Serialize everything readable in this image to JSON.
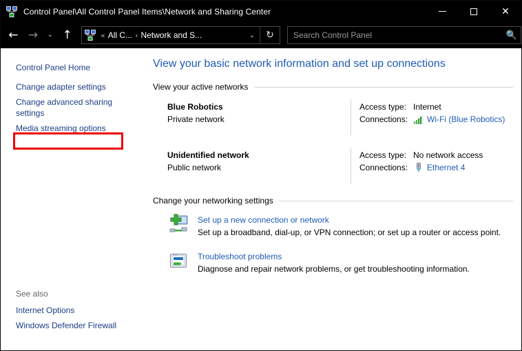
{
  "window": {
    "title": "Control Panel\\All Control Panel Items\\Network and Sharing Center",
    "icon": "network-sharing-center-icon",
    "controls": {
      "minimize": "—",
      "maximize": "□",
      "close": "✕"
    }
  },
  "nav": {
    "back": "←",
    "forward": "→",
    "recent": "⌄",
    "up": "↑",
    "breadcrumb": {
      "overflow": "«",
      "segments": [
        "All C...",
        "Network and S..."
      ],
      "separator": "›",
      "dropdown": "⌄"
    },
    "refresh": "↻"
  },
  "search": {
    "placeholder": "Search Control Panel",
    "value": "",
    "icon": "search-icon"
  },
  "sidebar": {
    "items": [
      {
        "label": "Control Panel Home",
        "highlighted": false
      },
      {
        "label": "Change adapter settings",
        "highlighted": true
      },
      {
        "label": "Change advanced sharing settings",
        "highlighted": false
      },
      {
        "label": "Media streaming options",
        "highlighted": false
      }
    ],
    "see_also": {
      "title": "See also",
      "items": [
        {
          "label": "Internet Options"
        },
        {
          "label": "Windows Defender Firewall"
        }
      ]
    }
  },
  "main": {
    "page_title": "View your basic network information and set up connections",
    "active_networks": {
      "heading": "View your active networks",
      "labels": {
        "access_type": "Access type:",
        "connections": "Connections:"
      },
      "rows": [
        {
          "name": "Blue Robotics",
          "type": "Private network",
          "access_type": "Internet",
          "connection": "Wi-Fi (Blue Robotics)",
          "connection_icon": "wifi-signal-icon"
        },
        {
          "name": "Unidentified network",
          "type": "Public network",
          "access_type": "No network access",
          "connection": "Ethernet 4",
          "connection_icon": "ethernet-plug-icon"
        }
      ]
    },
    "networking_settings": {
      "heading": "Change your networking settings",
      "items": [
        {
          "link": "Set up a new connection or network",
          "description": "Set up a broadband, dial-up, or VPN connection; or set up a router or access point.",
          "icon": "new-connection-icon"
        },
        {
          "link": "Troubleshoot problems",
          "description": "Diagnose and repair network problems, or get troubleshooting information.",
          "icon": "troubleshoot-icon"
        }
      ]
    }
  },
  "colors": {
    "titlebar_bg": "#000000",
    "link_blue": "#1f5bb5",
    "sidebar_link": "#1b3d86",
    "highlight_red": "#ee0000",
    "wifi_green": "#3aa03a"
  }
}
